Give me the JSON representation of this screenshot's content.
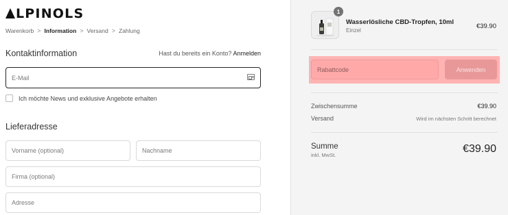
{
  "brand": {
    "logo_text": "LPINOLS"
  },
  "breadcrumb": {
    "items": [
      "Warenkorb",
      "Information",
      "Versand",
      "Zahlung"
    ],
    "separator": ">"
  },
  "contact": {
    "title": "Kontaktinformation",
    "login_prompt": "Hast du bereits ein Konto?",
    "login_link": "Anmelden",
    "email_placeholder": "E-Mail",
    "newsletter_label": "Ich möchte News und exklusive Angebote erhalten"
  },
  "shipping": {
    "title": "Lieferadresse",
    "first_name_placeholder": "Vorname (optional)",
    "last_name_placeholder": "Nachname",
    "company_placeholder": "Firma (optional)",
    "address_placeholder": "Adresse"
  },
  "summary": {
    "product": {
      "name": "Wasserlösliche CBD-Tropfen, 10ml",
      "variant": "Einzel",
      "price": "€39.90",
      "quantity": "1"
    },
    "discount": {
      "placeholder": "Rabattcode",
      "button_label": "Anwenden"
    },
    "subtotal_label": "Zwischensumme",
    "subtotal_value": "€39.90",
    "shipping_label": "Versand",
    "shipping_value": "Wird im nächsten Schritt berechnet",
    "total_label": "Summe",
    "total_sub": "inkl. MwSt.",
    "total_value": "€39.90"
  },
  "colors": {
    "highlight": "#ffb3b3",
    "apply_button": "#e89898",
    "panel_bg": "#f4f4f4"
  }
}
